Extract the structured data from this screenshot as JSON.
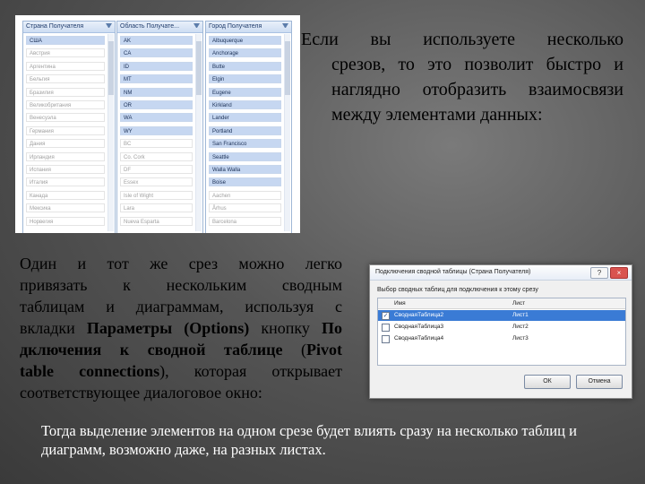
{
  "slicers": [
    {
      "header": "Страна Получателя",
      "items": [
        {
          "label": "США",
          "state": "on"
        },
        {
          "label": "Австрия",
          "state": "off"
        },
        {
          "label": "Аргентина",
          "state": "off"
        },
        {
          "label": "Бельгия",
          "state": "off"
        },
        {
          "label": "Бразилия",
          "state": "off"
        },
        {
          "label": "Великобритания",
          "state": "off"
        },
        {
          "label": "Венесуэла",
          "state": "off"
        },
        {
          "label": "Германия",
          "state": "off"
        },
        {
          "label": "Дания",
          "state": "off"
        },
        {
          "label": "Ирландия",
          "state": "off"
        },
        {
          "label": "Испания",
          "state": "off"
        },
        {
          "label": "Италия",
          "state": "off"
        },
        {
          "label": "Канада",
          "state": "off"
        },
        {
          "label": "Мексика",
          "state": "off"
        },
        {
          "label": "Норвегия",
          "state": "off"
        }
      ]
    },
    {
      "header": "Область Получате...",
      "items": [
        {
          "label": "AK",
          "state": "on"
        },
        {
          "label": "CA",
          "state": "on"
        },
        {
          "label": "ID",
          "state": "on"
        },
        {
          "label": "MT",
          "state": "on"
        },
        {
          "label": "NM",
          "state": "on"
        },
        {
          "label": "OR",
          "state": "on"
        },
        {
          "label": "WA",
          "state": "on"
        },
        {
          "label": "WY",
          "state": "on"
        },
        {
          "label": "BC",
          "state": "off"
        },
        {
          "label": "Co. Cork",
          "state": "off"
        },
        {
          "label": "DF",
          "state": "off"
        },
        {
          "label": "Essex",
          "state": "off"
        },
        {
          "label": "Isle of Wight",
          "state": "off"
        },
        {
          "label": "Lara",
          "state": "off"
        },
        {
          "label": "Nueva Esparta",
          "state": "off"
        }
      ]
    },
    {
      "header": "Город Получателя",
      "items": [
        {
          "label": "Albuquerque",
          "state": "on"
        },
        {
          "label": "Anchorage",
          "state": "on"
        },
        {
          "label": "Butte",
          "state": "on"
        },
        {
          "label": "Elgin",
          "state": "on"
        },
        {
          "label": "Eugene",
          "state": "on"
        },
        {
          "label": "Kirkland",
          "state": "on"
        },
        {
          "label": "Lander",
          "state": "on"
        },
        {
          "label": "Portland",
          "state": "on"
        },
        {
          "label": "San Francisco",
          "state": "on"
        },
        {
          "label": "Seattle",
          "state": "on"
        },
        {
          "label": "Walla Walla",
          "state": "on"
        },
        {
          "label": "Boise",
          "state": "on"
        },
        {
          "label": "Aachen",
          "state": "off"
        },
        {
          "label": "Århus",
          "state": "off"
        },
        {
          "label": "Barcelona",
          "state": "off"
        }
      ]
    }
  ],
  "paragraph1": {
    "lines": [
      "Если вы используете несколько",
      "срезов, то это позволит быстро и",
      "наглядно отобразить взаимосвязи",
      "между элементами данных:"
    ]
  },
  "paragraph2": {
    "l1": "Один и тот же срез можно легко",
    "l2": "привязать к нескольким сводным",
    "l3": "таблицам и диаграммам, используя с",
    "l4_pre": "вкладки ",
    "l4_bold": "Параметры (Options)",
    "l4_post": " кнопку ",
    "l4_bold2": "По",
    "l5_bold": "дключения к сводной таблице",
    "l5_post": " (",
    "l5_bold2": "Pivot",
    "l6_bold": "table connections",
    "l6_post": "), которая открывает",
    "l7": "соответствующее диалоговое окно:"
  },
  "paragraph3": "Тогда выделение элементов на одном срезе будет влиять сразу на несколько таблиц и диаграмм, возможно даже, на разных листах.",
  "dialog": {
    "title": "Подключения сводной таблицы (Страна Получателя)",
    "help": "?",
    "close": "×",
    "label": "Выбор сводных таблиц для подключения к этому срезу",
    "col_name": "Имя",
    "col_sheet": "Лист",
    "rows": [
      {
        "name": "СводнаяТаблица2",
        "sheet": "Лист1",
        "checked": true,
        "selected": true
      },
      {
        "name": "СводнаяТаблица3",
        "sheet": "Лист2",
        "checked": false,
        "selected": false
      },
      {
        "name": "СводнаяТаблица4",
        "sheet": "Лист3",
        "checked": false,
        "selected": false
      }
    ],
    "ok": "ОК",
    "cancel": "Отмена"
  }
}
